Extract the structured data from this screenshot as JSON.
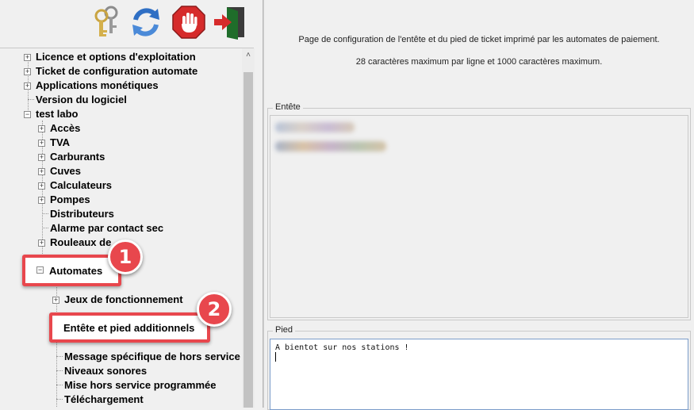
{
  "toolbar": {
    "buttons": [
      {
        "name": "keys",
        "icon": "keys-icon"
      },
      {
        "name": "refresh",
        "icon": "refresh-icon"
      },
      {
        "name": "stop",
        "icon": "stop-hand-icon"
      },
      {
        "name": "exit",
        "icon": "exit-door-icon"
      }
    ]
  },
  "tree": {
    "items": [
      {
        "label": "Licence et options d'exploitation",
        "expander": "+"
      },
      {
        "label": "Ticket de configuration automate",
        "expander": "+"
      },
      {
        "label": "Applications monétiques",
        "expander": "+"
      },
      {
        "label": "Version du logiciel",
        "expander": ""
      },
      {
        "label": "test labo",
        "expander": "−"
      },
      {
        "label": "Accès",
        "expander": "+"
      },
      {
        "label": "TVA",
        "expander": "+"
      },
      {
        "label": "Carburants",
        "expander": "+"
      },
      {
        "label": "Cuves",
        "expander": "+"
      },
      {
        "label": "Calculateurs",
        "expander": "+"
      },
      {
        "label": "Pompes",
        "expander": "+"
      },
      {
        "label": "Distributeurs",
        "expander": ""
      },
      {
        "label": "Alarme par contact sec",
        "expander": ""
      },
      {
        "label": "Rouleaux de ...",
        "expander": "+"
      },
      {
        "label": "Automates",
        "expander": "−"
      },
      {
        "label": "Jeux de fonctionnement",
        "expander": "+"
      },
      {
        "label": "Entête et pied additionnels",
        "expander": ""
      },
      {
        "label": "Message spécifique de hors service",
        "expander": ""
      },
      {
        "label": "Niveaux sonores",
        "expander": ""
      },
      {
        "label": "Mise hors service programmée",
        "expander": ""
      },
      {
        "label": "Téléchargement",
        "expander": ""
      }
    ]
  },
  "callouts": [
    {
      "number": "1",
      "target": "Automates"
    },
    {
      "number": "2",
      "target": "Entête et pied additionnels"
    }
  ],
  "main": {
    "description_line1": "Page de configuration de l'entête et du pied de ticket imprimé par les automates de paiement.",
    "description_line2": "28 caractères maximum par ligne et 1000 caractères maximum.",
    "entete_label": "Entête",
    "pied_label": "Pied",
    "pied_text": "A bientot sur nos stations !"
  },
  "colors": {
    "callout": "#e8474d",
    "refresh_blue": "#2f6fc4",
    "stop_red": "#d62b2b"
  }
}
